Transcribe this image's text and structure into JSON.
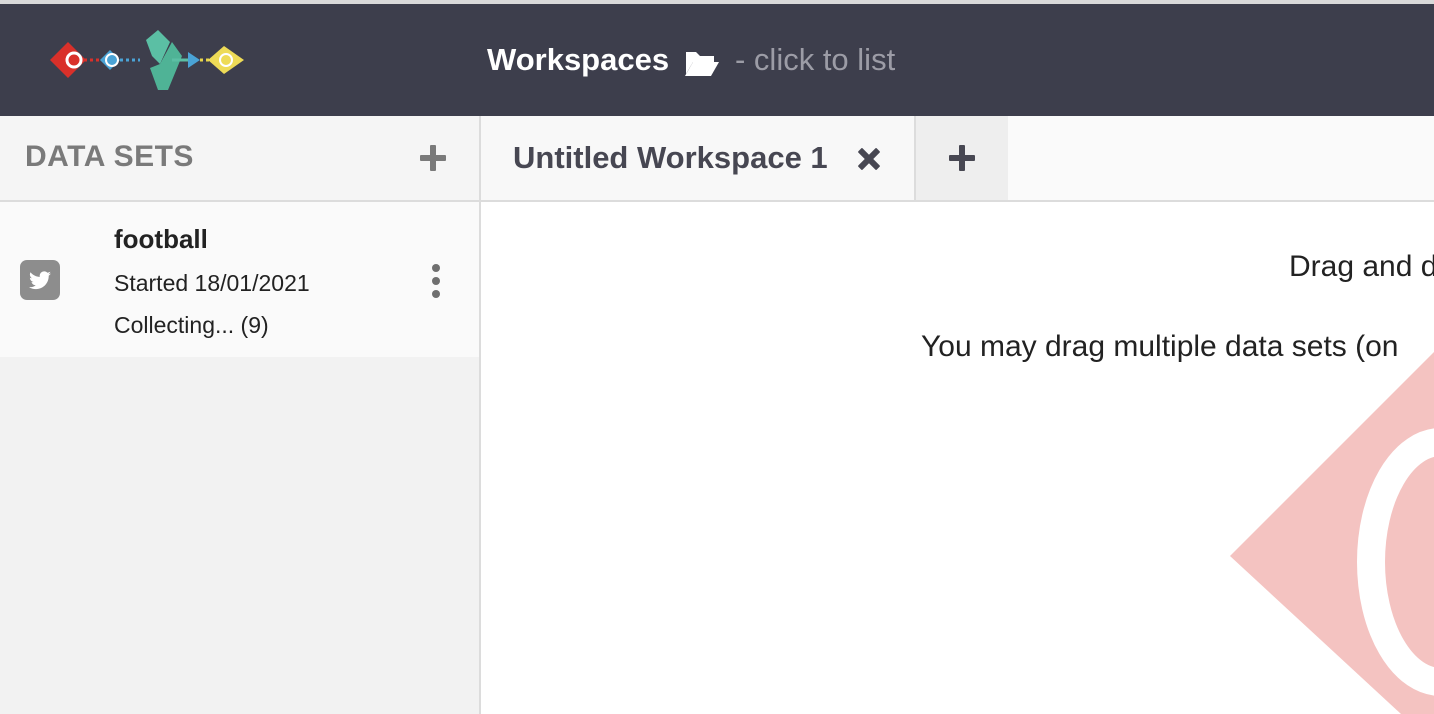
{
  "header": {
    "title": "Workspaces",
    "hint": "- click to list",
    "folder_icon": "folder-open-icon",
    "background": "#3d3e4c"
  },
  "sidebar": {
    "title": "DATA SETS",
    "add_icon": "plus-icon",
    "datasets": [
      {
        "name": "football",
        "started": "Started 18/01/2021",
        "status": "Collecting... (9)",
        "icon": "twitter-icon",
        "menu_icon": "kebab-menu-icon"
      }
    ]
  },
  "tabs": [
    {
      "label": "Untitled Workspace 1",
      "close_icon": "close-icon",
      "active": true
    }
  ],
  "add_tab_icon": "plus-icon",
  "main": {
    "drop_title": "Drag and d",
    "drop_subtitle": "You may drag multiple data sets (on",
    "watermark_color": "#f4c3c1"
  }
}
